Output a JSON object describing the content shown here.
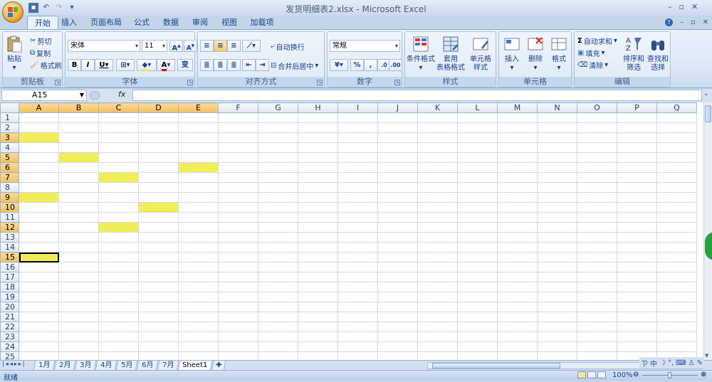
{
  "app": {
    "title": "发货明细表2.xlsx - Microsoft Excel",
    "logo_name": "office-button"
  },
  "colors": {
    "accent": "#15428b",
    "highlight": "#f0ee57",
    "header_selected": "#f1c15f"
  },
  "ribbon_tabs": [
    "开始",
    "插入",
    "页面布局",
    "公式",
    "数据",
    "审阅",
    "视图",
    "加载项"
  ],
  "clipboard": {
    "paste": "粘贴",
    "cut": "剪切",
    "copy": "复制",
    "format_painter": "格式刷",
    "label": "剪贴板"
  },
  "font": {
    "name": "宋体",
    "size": "11",
    "bold": "B",
    "italic": "I",
    "underline": "U",
    "grow": "A",
    "shrink": "A",
    "color_a": "A",
    "wen": "变",
    "label": "字体"
  },
  "alignment": {
    "wrap": "自动换行",
    "merge": "合并后居中",
    "label": "对齐方式"
  },
  "number": {
    "format": "常规",
    "percent": "%",
    "comma": ",",
    "label": "数字"
  },
  "styles": {
    "conditional": [
      "条件格式"
    ],
    "table": [
      "套用",
      "表格格式"
    ],
    "cell": [
      "单元格",
      "样式"
    ],
    "label": "样式"
  },
  "cells": {
    "insert": "插入",
    "delete": "删除",
    "format": "格式",
    "label": "单元格"
  },
  "editing": {
    "autosum": "自动求和",
    "fill": "填充",
    "clear": "清除",
    "sort": [
      "排序和",
      "筛选"
    ],
    "find": [
      "查找和",
      "选择"
    ],
    "label": "编辑"
  },
  "formula_bar": {
    "name_box": "A15",
    "fx": "fx"
  },
  "grid": {
    "columns": [
      "A",
      "B",
      "C",
      "D",
      "E",
      "F",
      "G",
      "H",
      "I",
      "J",
      "K",
      "L",
      "M",
      "N",
      "O",
      "P",
      "Q"
    ],
    "rows": [
      "1",
      "2",
      "3",
      "4",
      "5",
      "6",
      "7",
      "8",
      "9",
      "10",
      "11",
      "12",
      "13",
      "14",
      "15",
      "16",
      "17",
      "18",
      "19",
      "20",
      "21",
      "22",
      "23",
      "24",
      "25"
    ],
    "active_cell": "A15",
    "highlighted": [
      "A3",
      "B5",
      "E6",
      "C7",
      "A9",
      "D10",
      "C12",
      "A15"
    ]
  },
  "sheet_tabs": [
    "1月",
    "2月",
    "3月",
    "4月",
    "5月",
    "6月",
    "7月",
    "Sheet1"
  ],
  "active_sheet": "Sheet1",
  "status": {
    "ready": "就绪",
    "zoom": "100%"
  },
  "ime": {
    "label": "中"
  }
}
